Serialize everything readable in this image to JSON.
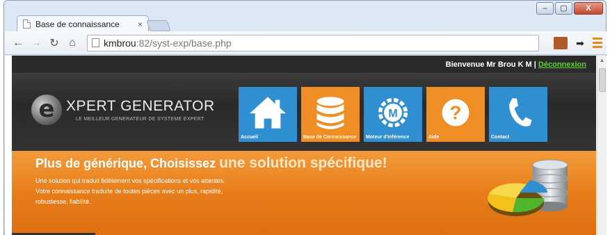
{
  "browser": {
    "tab_title": "Base de connaissance",
    "tab_close": "×",
    "url_host": "kmbrou",
    "url_path": ":82/syst-exp/base.php",
    "window_controls": {
      "minimize": "–",
      "maximize": "▢",
      "close": "X"
    }
  },
  "site": {
    "welcome": "Bienvenue Mr Brou K M | ",
    "logout": "Déconnexion",
    "logo": {
      "letter": "e",
      "title": "XPERT GENERATOR",
      "subtitle": "LE MEILLEUR GENERATEUR DE SYSTEME EXPERT"
    },
    "nav": [
      {
        "label": "Accueil",
        "icon": "home-icon",
        "color": "#2f8fd0"
      },
      {
        "label": "Base de Connaissance",
        "icon": "database-icon",
        "color": "#ee8e25"
      },
      {
        "label": "Moteur d'inférence",
        "icon": "engine-icon",
        "color": "#2f8fd0"
      },
      {
        "label": "Aide",
        "icon": "help-icon",
        "color": "#ee8e25"
      },
      {
        "label": "Contact",
        "icon": "phone-icon",
        "color": "#2f8fd0"
      }
    ],
    "banner": {
      "title_part1": "Plus de générique, Choisissez ",
      "title_part2": "une solution spécifique!",
      "line1": "Une solution qui traduit fidèlement vos spécifications et vos attentes.",
      "line2": "Votre connaissance traduite de toutes pièces avec un plus, rapidité,",
      "line3": "robustesse, fiabilité."
    }
  },
  "colors": {
    "accent_blue": "#2f8fd0",
    "accent_orange": "#ee8e25",
    "logout_green": "#5fd32f"
  }
}
